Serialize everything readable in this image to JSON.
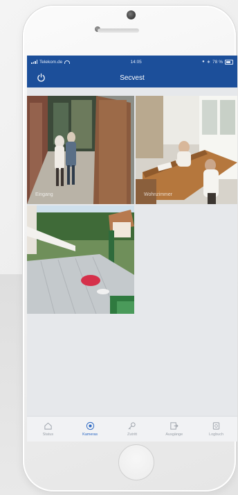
{
  "status_bar": {
    "carrier": "Telekom.de",
    "time": "14:05",
    "battery": "78 %"
  },
  "header": {
    "title": "Secvest"
  },
  "cameras": [
    {
      "label": "Eingang"
    },
    {
      "label": "Wohnzimmer"
    },
    {
      "label": ""
    }
  ],
  "tabs": [
    {
      "label": "Status",
      "icon": "home-icon",
      "active": false
    },
    {
      "label": "Kameras",
      "icon": "camera-icon",
      "active": true
    },
    {
      "label": "Zutritt",
      "icon": "key-icon",
      "active": false
    },
    {
      "label": "Ausgänge",
      "icon": "exit-icon",
      "active": false
    },
    {
      "label": "Logbuch",
      "icon": "logbook-icon",
      "active": false
    }
  ],
  "colors": {
    "header_blue": "#1c4f9a",
    "tab_active": "#2a67c3",
    "tab_inactive": "#9aa0a8"
  }
}
